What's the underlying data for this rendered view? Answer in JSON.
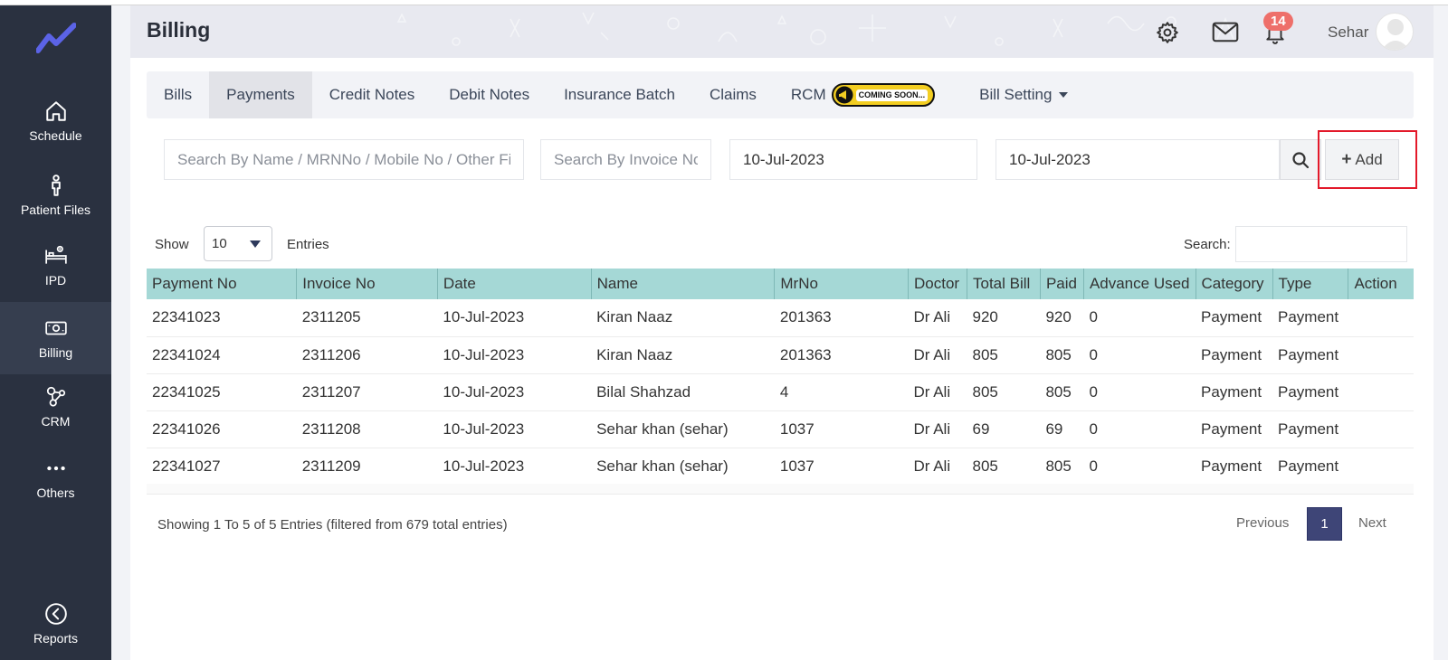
{
  "sidebar": {
    "items": [
      {
        "label": "Schedule",
        "icon": "home-icon"
      },
      {
        "label": "Patient Files",
        "icon": "person-icon"
      },
      {
        "label": "IPD",
        "icon": "bed-icon"
      },
      {
        "label": "Billing",
        "icon": "money-icon"
      },
      {
        "label": "CRM",
        "icon": "network-icon"
      },
      {
        "label": "Others",
        "icon": "more-icon"
      },
      {
        "label": "Reports",
        "icon": "chart-icon"
      }
    ]
  },
  "header": {
    "title": "Billing",
    "notification_count": "14",
    "user_name": "Sehar"
  },
  "tabs": {
    "bills": "Bills",
    "payments": "Payments",
    "credit_notes": "Credit Notes",
    "debit_notes": "Debit Notes",
    "insurance_batch": "Insurance Batch",
    "claims": "Claims",
    "rcm": "RCM",
    "coming_soon": "COMING SOON...",
    "bill_setting": "Bill Setting"
  },
  "filters": {
    "search_name_placeholder": "Search By Name / MRNNo / Mobile No / Other Fields",
    "search_invoice_placeholder": "Search By Invoice No",
    "date_from": "10-Jul-2023",
    "date_to": "10-Jul-2023",
    "add_label": "Add"
  },
  "table_controls": {
    "show_label": "Show",
    "entries_value": "10",
    "entries_label": "Entries",
    "search_label": "Search:"
  },
  "table": {
    "columns": [
      "Payment No",
      "Invoice No",
      "Date",
      "Name",
      "MrNo",
      "Doctor",
      "Total Bill",
      "Paid",
      "Advance Used",
      "Category",
      "Type",
      "Action"
    ],
    "rows": [
      [
        "22341023",
        "2311205",
        "10-Jul-2023",
        "Kiran Naaz",
        "201363",
        "Dr Ali",
        "920",
        "920",
        "0",
        "Payment",
        "Payment",
        ""
      ],
      [
        "22341024",
        "2311206",
        "10-Jul-2023",
        "Kiran Naaz",
        "201363",
        "Dr Ali",
        "805",
        "805",
        "0",
        "Payment",
        "Payment",
        ""
      ],
      [
        "22341025",
        "2311207",
        "10-Jul-2023",
        "Bilal Shahzad",
        "4",
        "Dr Ali",
        "805",
        "805",
        "0",
        "Payment",
        "Payment",
        ""
      ],
      [
        "22341026",
        "2311208",
        "10-Jul-2023",
        "Sehar khan (sehar)",
        "1037",
        "Dr Ali",
        "69",
        "69",
        "0",
        "Payment",
        "Payment",
        ""
      ],
      [
        "22341027",
        "2311209",
        "10-Jul-2023",
        "Sehar khan (sehar)",
        "1037",
        "Dr Ali",
        "805",
        "805",
        "0",
        "Payment",
        "Payment",
        ""
      ]
    ]
  },
  "pagination": {
    "showing": "Showing 1 To 5 of 5 Entries (filtered from 679 total entries)",
    "previous": "Previous",
    "page": "1",
    "next": "Next"
  },
  "colors": {
    "sidebar_bg": "#2a3140",
    "table_header_bg": "#a5d8d6",
    "active_page_bg": "#3e4577",
    "badge_bg": "#ee6f6a",
    "highlight_border": "#e3192a"
  }
}
